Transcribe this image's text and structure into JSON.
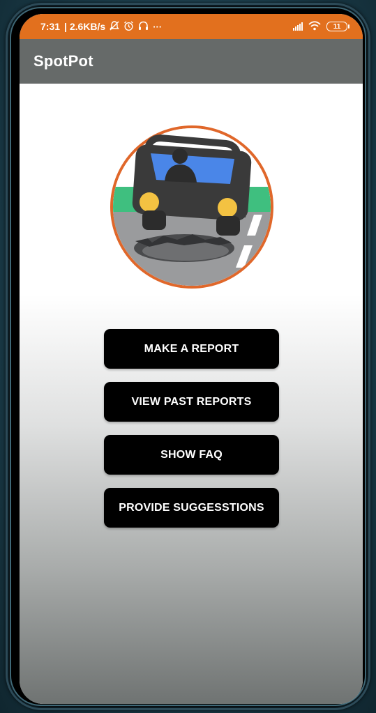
{
  "status_bar": {
    "time": "7:31",
    "net_speed": "| 2.6KB/s",
    "icons_left": [
      "mute-icon",
      "alarm-icon",
      "headphones-icon",
      "more-dots-icon"
    ],
    "more_dots": "···",
    "battery_level": "11",
    "background": "#e2701e"
  },
  "app_bar": {
    "title": "SpotPot",
    "background": "#666a69"
  },
  "logo": {
    "icon": "car-pothole-logo",
    "ring_color": "#e0672a"
  },
  "buttons": [
    {
      "label": "MAKE A REPORT"
    },
    {
      "label": "VIEW PAST REPORTS"
    },
    {
      "label": "SHOW FAQ"
    },
    {
      "label": "PROVIDE SUGGESSTIONS"
    }
  ]
}
